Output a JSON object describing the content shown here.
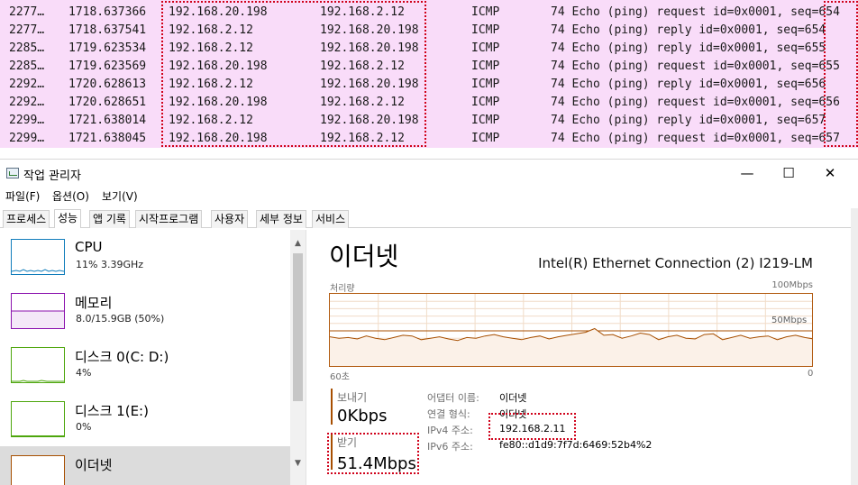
{
  "packets": {
    "rows": [
      {
        "no": "2277…",
        "time": "1718.637366",
        "src": "192.168.20.198",
        "dst": "192.168.2.12",
        "proto": "ICMP",
        "info": "74 Echo (ping) request  id=0x0001, seq=654"
      },
      {
        "no": "2277…",
        "time": "1718.637541",
        "src": "192.168.2.12",
        "dst": "192.168.20.198",
        "proto": "ICMP",
        "info": "74 Echo (ping) reply    id=0x0001, seq=654"
      },
      {
        "no": "2285…",
        "time": "1719.623534",
        "src": "192.168.2.12",
        "dst": "192.168.20.198",
        "proto": "ICMP",
        "info": "74 Echo (ping) reply    id=0x0001, seq=655"
      },
      {
        "no": "2285…",
        "time": "1719.623569",
        "src": "192.168.20.198",
        "dst": "192.168.2.12",
        "proto": "ICMP",
        "info": "74 Echo (ping) request  id=0x0001, seq=655"
      },
      {
        "no": "2292…",
        "time": "1720.628613",
        "src": "192.168.2.12",
        "dst": "192.168.20.198",
        "proto": "ICMP",
        "info": "74 Echo (ping) reply    id=0x0001, seq=656"
      },
      {
        "no": "2292…",
        "time": "1720.628651",
        "src": "192.168.20.198",
        "dst": "192.168.2.12",
        "proto": "ICMP",
        "info": "74 Echo (ping) request  id=0x0001, seq=656"
      },
      {
        "no": "2299…",
        "time": "1721.638014",
        "src": "192.168.2.12",
        "dst": "192.168.20.198",
        "proto": "ICMP",
        "info": "74 Echo (ping) reply    id=0x0001, seq=657"
      },
      {
        "no": "2299…",
        "time": "1721.638045",
        "src": "192.168.20.198",
        "dst": "192.168.2.12",
        "proto": "ICMP",
        "info": "74 Echo (ping) request  id=0x0001, seq=657"
      }
    ]
  },
  "window": {
    "title": "작업 관리자",
    "minimize": "—",
    "maximize": "☐",
    "close": "✕"
  },
  "menu": [
    "파일(F)",
    "옵션(O)",
    "보기(V)"
  ],
  "tabs": [
    "프로세스",
    "성능",
    "앱 기록",
    "시작프로그램",
    "사용자",
    "세부 정보",
    "서비스"
  ],
  "active_tab": "성능",
  "resources": [
    {
      "name": "CPU",
      "sub": "11% 3.39GHz",
      "color": "#117dbb"
    },
    {
      "name": "메모리",
      "sub": "8.0/15.9GB (50%)",
      "color": "#8b12ae"
    },
    {
      "name": "디스크 0(C: D:)",
      "sub": "4%",
      "color": "#4da60c"
    },
    {
      "name": "디스크 1(E:)",
      "sub": "0%",
      "color": "#4da60c"
    },
    {
      "name": "이더넷",
      "sub": "",
      "color": "#a74f01"
    }
  ],
  "scroll": {
    "up": "▲",
    "down": "▼"
  },
  "detail": {
    "title": "이더넷",
    "adapter": "Intel(R) Ethernet Connection (2) I219-LM",
    "graph_label": "처리량",
    "graph_max": "100Mbps",
    "graph_mid": "50Mbps",
    "time_left": "60초",
    "time_right": "0",
    "graph_color": "#a74f01",
    "throughput_pct": [
      42,
      40,
      41,
      39,
      43,
      40,
      38,
      41,
      44,
      43,
      38,
      40,
      42,
      39,
      37,
      41,
      40,
      43,
      45,
      42,
      40,
      38,
      41,
      43,
      39,
      42,
      44,
      46,
      48,
      53,
      44,
      45,
      40,
      43,
      47,
      45,
      38,
      42,
      44,
      40,
      39,
      45,
      46,
      38,
      41,
      44,
      40,
      42,
      43,
      38,
      42,
      44,
      41,
      39
    ]
  },
  "stats": {
    "send_label": "보내기",
    "send_value": "0Kbps",
    "recv_label": "받기",
    "recv_value": "51.4Mbps"
  },
  "props": {
    "adapter_name_key": "어댑터 이름:",
    "adapter_name_val": "이더넷",
    "conn_type_key": "연결 형식:",
    "conn_type_val": "이더넷",
    "ipv4_key": "IPv4 주소:",
    "ipv4_val": "192.168.2.11",
    "ipv6_key": "IPv6 주소:",
    "ipv6_val": "fe80::d1d9:7f7d:6469:52b4%2"
  },
  "highlight_color": "#d0021b"
}
